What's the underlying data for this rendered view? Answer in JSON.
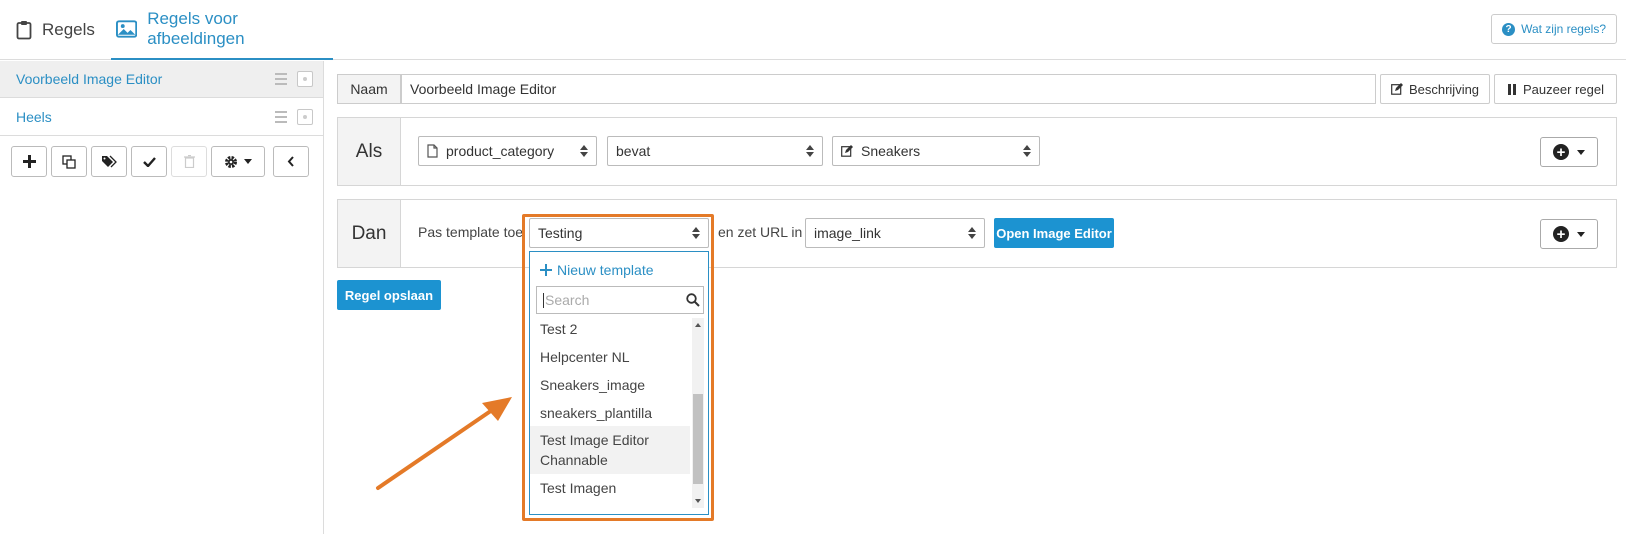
{
  "tabs": [
    {
      "label": "Regels",
      "icon": "clipboard-icon"
    },
    {
      "label": "Regels voor afbeeldingen",
      "icon": "image-icon",
      "active": true
    }
  ],
  "help_button": "Wat zijn regels?",
  "sidebar": {
    "items": [
      {
        "label": "Voorbeeld Image Editor",
        "active": true
      },
      {
        "label": "Heels"
      }
    ]
  },
  "naam": {
    "label": "Naam",
    "value": "Voorbeeld Image Editor"
  },
  "buttons": {
    "beschrijving": "Beschrijving",
    "pauzeer": "Pauzeer regel",
    "open_editor": "Open Image Editor",
    "save": "Regel opslaan"
  },
  "als": {
    "label": "Als",
    "field": "product_category",
    "operator": "bevat",
    "value": "Sneakers"
  },
  "dan": {
    "label": "Dan",
    "prefix": "Pas template toe",
    "template": "Testing",
    "middle": "en zet URL in",
    "url_field": "image_link"
  },
  "dropdown": {
    "new_label": "Nieuw template",
    "search_placeholder": "Search",
    "items": [
      "Test 2",
      "Helpcenter NL",
      "Sneakers_image",
      "sneakers_plantilla",
      "Test Image Editor Channable",
      "Test Imagen"
    ]
  },
  "colors": {
    "accent": "#2b8fc4",
    "primary": "#1c93d1",
    "highlight": "#e47a28"
  }
}
